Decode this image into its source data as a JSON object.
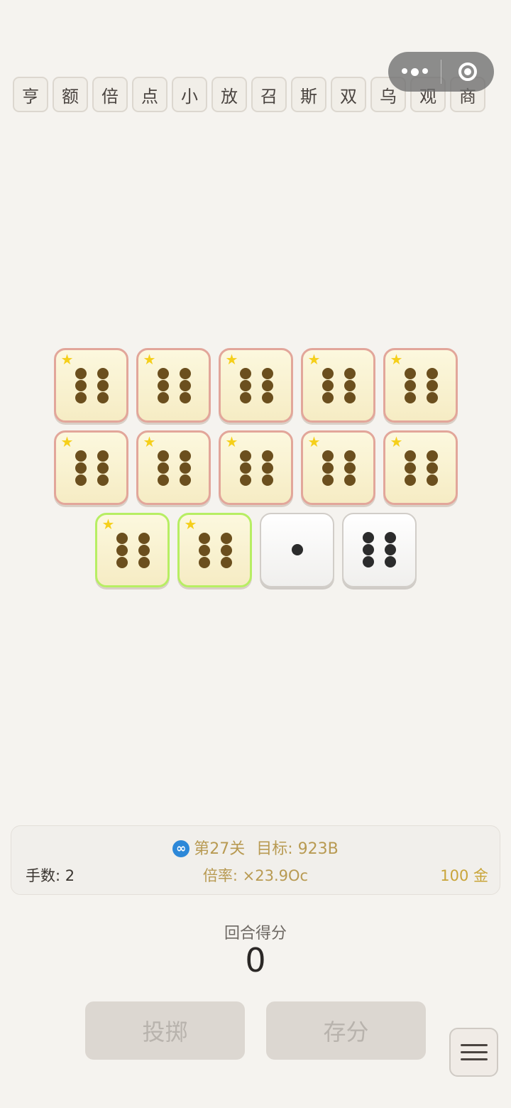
{
  "tags": [
    "亨",
    "额",
    "倍",
    "点",
    "小",
    "放",
    "召",
    "斯",
    "双",
    "乌",
    "观",
    "商"
  ],
  "capsule": {
    "more_icon": "more-dots-icon",
    "close_icon": "target-circle-icon"
  },
  "dice": {
    "star_symbol": "★",
    "rows": [
      [
        {
          "value": 6,
          "state": "scored"
        },
        {
          "value": 6,
          "state": "scored"
        },
        {
          "value": 6,
          "state": "scored"
        },
        {
          "value": 6,
          "state": "scored"
        },
        {
          "value": 6,
          "state": "scored"
        }
      ],
      [
        {
          "value": 6,
          "state": "scored"
        },
        {
          "value": 6,
          "state": "scored"
        },
        {
          "value": 6,
          "state": "scored"
        },
        {
          "value": 6,
          "state": "scored"
        },
        {
          "value": 6,
          "state": "scored"
        }
      ],
      [
        {
          "value": 6,
          "state": "held"
        },
        {
          "value": 6,
          "state": "held"
        },
        {
          "value": 1,
          "state": "free"
        },
        {
          "value": 6,
          "state": "free"
        }
      ]
    ]
  },
  "info": {
    "infinity_icon": "∞",
    "level": "第27关",
    "target": "目标: 923B",
    "hands": "手数: 2",
    "multiplier": "倍率: ×23.9Oc",
    "gold": "100 金"
  },
  "round": {
    "label": "回合得分",
    "score": "0"
  },
  "buttons": {
    "roll": "投掷",
    "bank": "存分"
  },
  "colors": {
    "background": "#f5f3ef",
    "scored_border": "#e2a69a",
    "held_border": "#b7ee63",
    "gold_text": "#c9a53a",
    "accent_text": "#b89a52"
  }
}
